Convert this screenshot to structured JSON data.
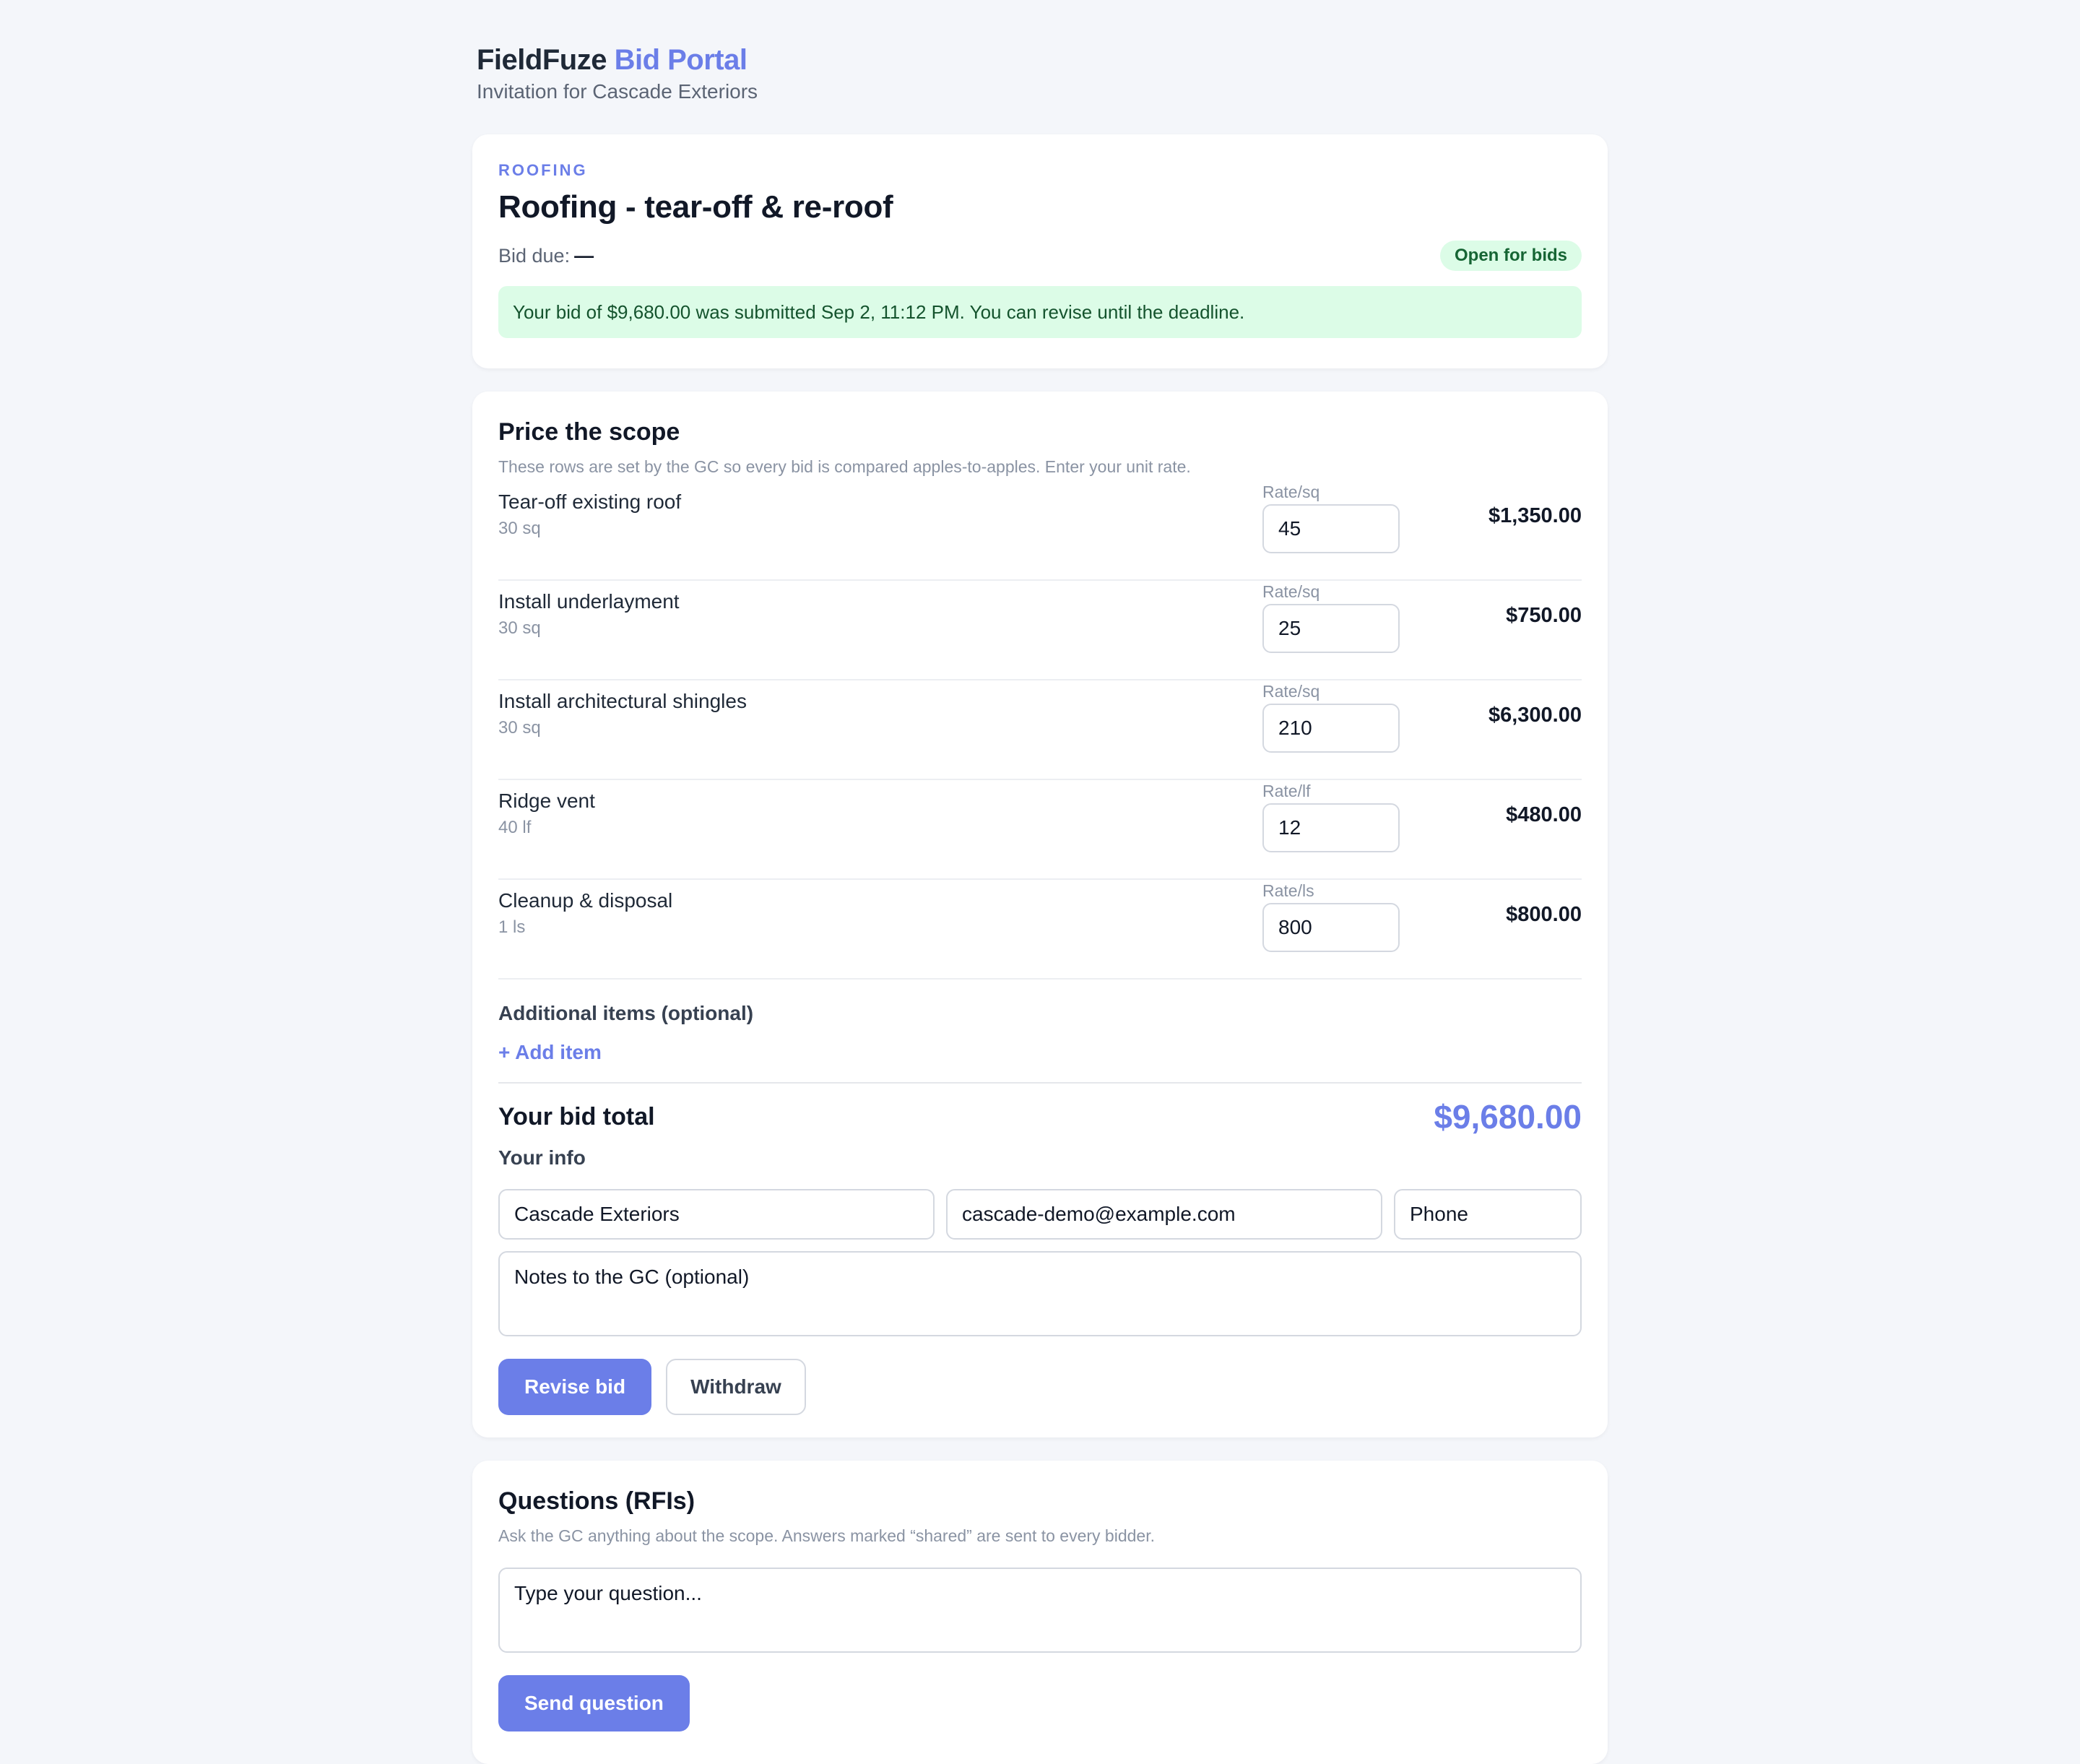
{
  "brand": {
    "name": "FieldFuze",
    "product": "Bid Portal",
    "subtitle": "Invitation for Cascade Exteriors"
  },
  "invite": {
    "trade": "ROOFING",
    "title": "Roofing - tear-off & re-roof",
    "bid_due_label": "Bid due:",
    "bid_due_value": "—",
    "status": "Open for bids",
    "status_color": "#dcfce7",
    "notice": "Your bid of $9,680.00 was submitted Sep 2, 11:12 PM. You can revise until the deadline."
  },
  "scope": {
    "title": "Price the scope",
    "help": "These rows are set by the GC so every bid is compared apples-to-apples. Enter your unit rate.",
    "lines": [
      {
        "name": "Tear-off existing roof",
        "qty": "30 sq",
        "rate_label": "Rate/sq",
        "rate": "45",
        "amount": "$1,350.00"
      },
      {
        "name": "Install underlayment",
        "qty": "30 sq",
        "rate_label": "Rate/sq",
        "rate": "25",
        "amount": "$750.00"
      },
      {
        "name": "Install architectural shingles",
        "qty": "30 sq",
        "rate_label": "Rate/sq",
        "rate": "210",
        "amount": "$6,300.00"
      },
      {
        "name": "Ridge vent",
        "qty": "40 lf",
        "rate_label": "Rate/lf",
        "rate": "12",
        "amount": "$480.00"
      },
      {
        "name": "Cleanup & disposal",
        "qty": "1 ls",
        "rate_label": "Rate/ls",
        "rate": "800",
        "amount": "$800.00"
      }
    ],
    "additional_title": "Additional items (optional)",
    "add_item_label": "+ Add item",
    "total_label": "Your bid total",
    "total_value": "$9,680.00",
    "accent_color": "#6b7ee8"
  },
  "info": {
    "title": "Your info",
    "company": "Cascade Exteriors",
    "email": "cascade-demo@example.com",
    "phone_placeholder": "Phone",
    "notes_placeholder": "Notes to the GC (optional)",
    "revise_label": "Revise bid",
    "withdraw_label": "Withdraw"
  },
  "rfi": {
    "title": "Questions (RFIs)",
    "help": "Ask the GC anything about the scope. Answers marked “shared” are sent to every bidder.",
    "question_placeholder": "Type your question...",
    "send_label": "Send question"
  }
}
